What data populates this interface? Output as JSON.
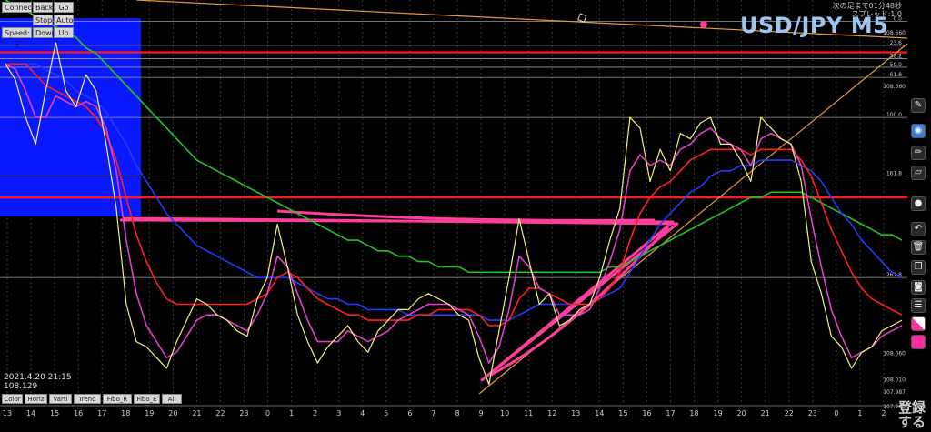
{
  "topbar": {
    "buttons": [
      "Connect",
      "Back",
      "Go",
      "Stop",
      "Auto",
      "Speed: 1",
      "Down",
      "Up"
    ]
  },
  "header": {
    "symbol": "USD/JPY M5",
    "countdown": "次の足まで01分48秒",
    "spread": "スプレッド:1.0"
  },
  "status": {
    "datetime": "2021.4.20 21:15",
    "price": "108.129"
  },
  "bottom_buttons": [
    "Color",
    "Horiz",
    "Varti",
    "Trend",
    "Fibo_R",
    "Fibo_E",
    "All"
  ],
  "record_label": "登録\nする",
  "colors": {
    "price_line": "#f5f27a",
    "ma_fast": "#e040c8",
    "ma_mid": "#ff2020",
    "ma_slow": "#1f3cff",
    "ma_long": "#21c521",
    "drawing": "#ff3d9a",
    "trendline": "#e89a3a",
    "level_red": "#ff1a1a",
    "highlight_box": "#0a18ff"
  },
  "toolbar_icons": [
    "cursor-icon",
    "eye-icon",
    "pencil-icon",
    "ruler-icon",
    "dot-icon",
    "undo-icon",
    "trash-icon",
    "copy-icon",
    "camera-icon",
    "list-icon",
    "palette-icon",
    "square-icon"
  ],
  "chart_data": {
    "type": "line",
    "title": "USD/JPY M5",
    "ylim": [
      107.96,
      108.72
    ],
    "x_ticks": [
      "13",
      "14",
      "15",
      "16",
      "17",
      "18",
      "19",
      "20",
      "21",
      "22",
      "23",
      "0",
      "1",
      "2",
      "3",
      "4",
      "5",
      "6",
      "7",
      "8",
      "9",
      "10",
      "11",
      "12",
      "13",
      "14",
      "15",
      "16",
      "17",
      "18",
      "19",
      "20",
      "21",
      "22",
      "23",
      "0",
      "1",
      "2"
    ],
    "y_ticks": [
      {
        "value": 108.66,
        "label": "108.660"
      },
      {
        "value": 108.56,
        "label": "108.560"
      },
      {
        "value": 108.06,
        "label": "108.060"
      },
      {
        "value": 108.01,
        "label": "108.010"
      },
      {
        "value": 107.987,
        "label": "107.987"
      },
      {
        "value": 107.96,
        "label": "107.960"
      }
    ],
    "fib_levels": [
      {
        "label": "0.0",
        "value": 108.68
      },
      {
        "label": "23.6",
        "value": 108.635
      },
      {
        "label": "38.2",
        "value": 108.61
      },
      {
        "label": "50.0",
        "value": 108.594
      },
      {
        "label": "61.8",
        "value": 108.575
      },
      {
        "label": "100.0",
        "value": 108.5
      },
      {
        "label": "161.8",
        "value": 108.39
      },
      {
        "label": "261.8",
        "value": 108.2
      }
    ],
    "red_levels": [
      108.622,
      108.35
    ],
    "series": [
      {
        "color": "#f5f27a",
        "values": [
          108.6,
          108.57,
          108.5,
          108.45,
          108.55,
          108.64,
          108.55,
          108.52,
          108.58,
          108.55,
          108.45,
          108.33,
          108.15,
          108.08,
          108.07,
          108.05,
          108.03,
          108.08,
          108.12,
          108.16,
          108.15,
          108.13,
          108.12,
          108.1,
          108.09,
          108.16,
          108.2,
          108.3,
          108.22,
          108.13,
          108.08,
          108.04,
          108.07,
          108.09,
          108.11,
          108.08,
          108.06,
          108.1,
          108.12,
          108.14,
          108.14,
          108.16,
          108.17,
          108.16,
          108.15,
          108.13,
          108.12,
          108.05,
          108.0,
          108.1,
          108.2,
          108.31,
          108.23,
          108.15,
          108.17,
          108.11,
          108.12,
          108.14,
          108.15,
          108.2,
          108.27,
          108.33,
          108.5,
          108.48,
          108.38,
          108.44,
          108.4,
          108.47,
          108.46,
          108.49,
          108.5,
          108.45,
          108.45,
          108.42,
          108.38,
          108.5,
          108.48,
          108.46,
          108.45,
          108.38,
          108.23,
          108.17,
          108.09,
          108.07,
          108.03,
          108.06,
          108.07,
          108.1,
          108.11,
          108.12
        ]
      },
      {
        "color": "#e040c8",
        "values": [
          108.6,
          108.59,
          108.55,
          108.5,
          108.5,
          108.54,
          108.53,
          108.52,
          108.53,
          108.52,
          108.48,
          108.4,
          108.27,
          108.17,
          108.11,
          108.08,
          108.05,
          108.06,
          108.09,
          108.12,
          108.13,
          108.13,
          108.12,
          108.11,
          108.1,
          108.13,
          108.17,
          108.24,
          108.22,
          108.17,
          108.12,
          108.08,
          108.08,
          108.08,
          108.1,
          108.09,
          108.08,
          108.09,
          108.1,
          108.12,
          108.13,
          108.14,
          108.15,
          108.15,
          108.15,
          108.14,
          108.13,
          108.09,
          108.04,
          108.07,
          108.14,
          108.24,
          108.22,
          108.18,
          108.17,
          108.13,
          108.13,
          108.13,
          108.14,
          108.18,
          108.23,
          108.29,
          108.4,
          108.43,
          108.41,
          108.42,
          108.41,
          108.44,
          108.45,
          108.47,
          108.48,
          108.46,
          108.45,
          108.44,
          108.41,
          108.46,
          108.47,
          108.46,
          108.45,
          108.41,
          108.31,
          108.22,
          108.14,
          108.09,
          108.05,
          108.06,
          108.07,
          108.09,
          108.1,
          108.11
        ]
      },
      {
        "color": "#ff2020",
        "values": [
          108.6,
          108.6,
          108.6,
          108.58,
          108.56,
          108.55,
          108.54,
          108.53,
          108.52,
          108.5,
          108.47,
          108.42,
          108.35,
          108.28,
          108.23,
          108.19,
          108.16,
          108.15,
          108.15,
          108.15,
          108.15,
          108.15,
          108.15,
          108.15,
          108.15,
          108.16,
          108.17,
          108.2,
          108.21,
          108.2,
          108.18,
          108.16,
          108.15,
          108.14,
          108.13,
          108.13,
          108.12,
          108.12,
          108.12,
          108.12,
          108.12,
          108.13,
          108.13,
          108.14,
          108.14,
          108.14,
          108.14,
          108.13,
          108.11,
          108.11,
          108.12,
          108.16,
          108.18,
          108.18,
          108.17,
          108.16,
          108.15,
          108.15,
          108.15,
          108.16,
          108.18,
          108.21,
          108.27,
          108.32,
          108.35,
          108.37,
          108.38,
          108.4,
          108.42,
          108.43,
          108.44,
          108.44,
          108.44,
          108.44,
          108.43,
          108.44,
          108.44,
          108.44,
          108.44,
          108.42,
          108.39,
          108.34,
          108.29,
          108.25,
          108.21,
          108.18,
          108.16,
          108.15,
          108.14,
          108.13
        ]
      },
      {
        "color": "#1f3cff",
        "values": [
          108.6,
          108.6,
          108.6,
          108.6,
          108.59,
          108.58,
          108.57,
          108.55,
          108.54,
          108.53,
          108.51,
          108.48,
          108.45,
          108.41,
          108.38,
          108.35,
          108.32,
          108.3,
          108.28,
          108.26,
          108.25,
          108.24,
          108.23,
          108.22,
          108.21,
          108.2,
          108.2,
          108.2,
          108.2,
          108.19,
          108.18,
          108.17,
          108.16,
          108.16,
          108.15,
          108.15,
          108.14,
          108.14,
          108.14,
          108.14,
          108.13,
          108.13,
          108.13,
          108.13,
          108.13,
          108.13,
          108.13,
          108.13,
          108.12,
          108.12,
          108.12,
          108.13,
          108.14,
          108.15,
          108.15,
          108.15,
          108.15,
          108.15,
          108.15,
          108.16,
          108.17,
          108.18,
          108.21,
          108.24,
          108.27,
          108.3,
          108.32,
          108.34,
          108.36,
          108.37,
          108.39,
          108.4,
          108.4,
          108.41,
          108.41,
          108.42,
          108.42,
          108.42,
          108.42,
          108.41,
          108.4,
          108.38,
          108.35,
          108.32,
          108.3,
          108.27,
          108.25,
          108.23,
          108.21,
          108.2
        ]
      },
      {
        "color": "#21c521",
        "values": [
          108.72,
          108.71,
          108.7,
          108.69,
          108.68,
          108.67,
          108.66,
          108.65,
          108.63,
          108.62,
          108.6,
          108.58,
          108.56,
          108.54,
          108.52,
          108.5,
          108.48,
          108.46,
          108.44,
          108.42,
          108.41,
          108.4,
          108.39,
          108.38,
          108.37,
          108.36,
          108.35,
          108.34,
          108.33,
          108.32,
          108.31,
          108.3,
          108.29,
          108.28,
          108.27,
          108.27,
          108.26,
          108.25,
          108.25,
          108.24,
          108.24,
          108.23,
          108.23,
          108.22,
          108.22,
          108.22,
          108.21,
          108.21,
          108.21,
          108.21,
          108.21,
          108.21,
          108.21,
          108.21,
          108.21,
          108.21,
          108.21,
          108.21,
          108.21,
          108.21,
          108.22,
          108.22,
          108.23,
          108.24,
          108.25,
          108.26,
          108.27,
          108.28,
          108.29,
          108.3,
          108.31,
          108.32,
          108.33,
          108.34,
          108.35,
          108.35,
          108.36,
          108.36,
          108.36,
          108.36,
          108.35,
          108.34,
          108.33,
          108.32,
          108.31,
          108.3,
          108.29,
          108.28,
          108.28,
          108.27
        ]
      }
    ]
  }
}
